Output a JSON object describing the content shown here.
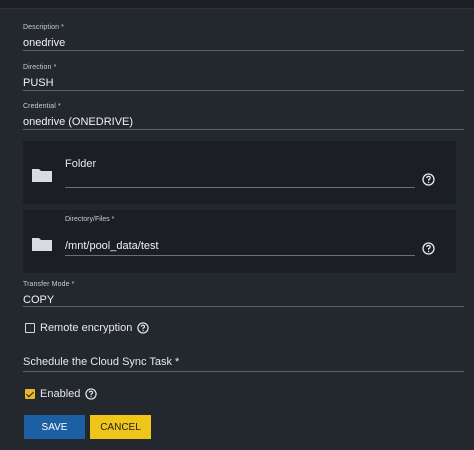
{
  "description": {
    "label": "Description *",
    "value": "onedrive"
  },
  "direction": {
    "label": "Direction *",
    "value": "PUSH"
  },
  "credential": {
    "label": "Credential *",
    "value": "onedrive (ONEDRIVE)"
  },
  "folder": {
    "label": "Folder",
    "value": "",
    "icon": "folder-icon",
    "help_icon": "help-icon"
  },
  "directory": {
    "label": "Directory/Files *",
    "value": "/mnt/pool_data/test",
    "icon": "folder-icon",
    "help_icon": "help-icon"
  },
  "transfer_mode": {
    "label": "Transfer Mode *",
    "value": "COPY"
  },
  "remote_encryption": {
    "label": "Remote encryption",
    "checked": false
  },
  "schedule": {
    "label": "Schedule the Cloud Sync Task *"
  },
  "enabled": {
    "label": "Enabled",
    "checked": true
  },
  "buttons": {
    "save": "SAVE",
    "cancel": "CANCEL"
  },
  "colors": {
    "background": "#23272e",
    "panel": "#1b1f25",
    "primary": "#1d5fa3",
    "accent": "#f0c51a",
    "check": "#e7b82a"
  }
}
